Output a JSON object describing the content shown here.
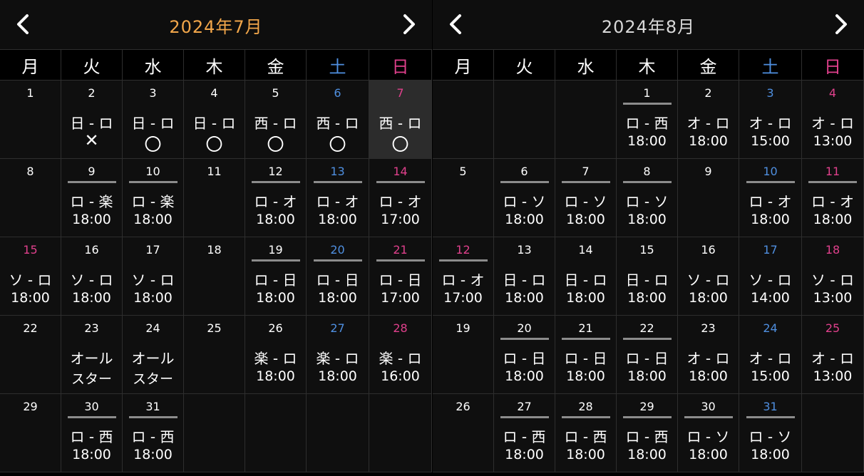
{
  "colors": {
    "title_july": "#f2a64a",
    "title_aug": "#d8d8d8",
    "saturday": "#4f8fe0",
    "sunday": "#e0408c"
  },
  "icons": {
    "prev": "chevron-left-icon",
    "next": "chevron-right-icon"
  },
  "weekdays": [
    "月",
    "火",
    "水",
    "木",
    "金",
    "土",
    "日"
  ],
  "months": [
    {
      "title": "2024年7月",
      "weeks": [
        [
          {
            "day": "1",
            "t1": "",
            "t2": "",
            "bar": false
          },
          {
            "day": "2",
            "t1": "日 - ロ",
            "t2": "✕",
            "bar": false
          },
          {
            "day": "3",
            "t1": "日 - ロ",
            "t2": "〇",
            "bar": false
          },
          {
            "day": "4",
            "t1": "日 - ロ",
            "t2": "〇",
            "bar": false
          },
          {
            "day": "5",
            "t1": "西 - ロ",
            "t2": "〇",
            "bar": false
          },
          {
            "day": "6",
            "t1": "西 - ロ",
            "t2": "〇",
            "bar": false
          },
          {
            "day": "7",
            "t1": "西 - ロ",
            "t2": "〇",
            "bar": false,
            "today": true
          }
        ],
        [
          {
            "day": "8",
            "t1": "",
            "t2": "",
            "bar": false
          },
          {
            "day": "9",
            "t1": "ロ - 楽",
            "t2": "18:00",
            "bar": true
          },
          {
            "day": "10",
            "t1": "ロ - 楽",
            "t2": "18:00",
            "bar": true
          },
          {
            "day": "11",
            "t1": "",
            "t2": "",
            "bar": false
          },
          {
            "day": "12",
            "t1": "ロ - オ",
            "t2": "18:00",
            "bar": true
          },
          {
            "day": "13",
            "t1": "ロ - オ",
            "t2": "18:00",
            "bar": true
          },
          {
            "day": "14",
            "t1": "ロ - オ",
            "t2": "17:00",
            "bar": true
          }
        ],
        [
          {
            "day": "15",
            "t1": "ソ - ロ",
            "t2": "18:00",
            "bar": false,
            "holiday": true
          },
          {
            "day": "16",
            "t1": "ソ - ロ",
            "t2": "18:00",
            "bar": false
          },
          {
            "day": "17",
            "t1": "ソ - ロ",
            "t2": "18:00",
            "bar": false
          },
          {
            "day": "18",
            "t1": "",
            "t2": "",
            "bar": false
          },
          {
            "day": "19",
            "t1": "ロ - 日",
            "t2": "18:00",
            "bar": true
          },
          {
            "day": "20",
            "t1": "ロ - 日",
            "t2": "18:00",
            "bar": true
          },
          {
            "day": "21",
            "t1": "ロ - 日",
            "t2": "17:00",
            "bar": true
          }
        ],
        [
          {
            "day": "22",
            "t1": "",
            "t2": "",
            "bar": false
          },
          {
            "day": "23",
            "t1": "オール",
            "t2": "スター",
            "bar": false
          },
          {
            "day": "24",
            "t1": "オール",
            "t2": "スター",
            "bar": false
          },
          {
            "day": "25",
            "t1": "",
            "t2": "",
            "bar": false
          },
          {
            "day": "26",
            "t1": "楽 - ロ",
            "t2": "18:00",
            "bar": false
          },
          {
            "day": "27",
            "t1": "楽 - ロ",
            "t2": "18:00",
            "bar": false
          },
          {
            "day": "28",
            "t1": "楽 - ロ",
            "t2": "16:00",
            "bar": false
          }
        ],
        [
          {
            "day": "29",
            "t1": "",
            "t2": "",
            "bar": false
          },
          {
            "day": "30",
            "t1": "ロ - 西",
            "t2": "18:00",
            "bar": true
          },
          {
            "day": "31",
            "t1": "ロ - 西",
            "t2": "18:00",
            "bar": true
          },
          null,
          null,
          null,
          null
        ]
      ]
    },
    {
      "title": "2024年8月",
      "weeks": [
        [
          null,
          null,
          null,
          {
            "day": "1",
            "t1": "ロ - 西",
            "t2": "18:00",
            "bar": true
          },
          {
            "day": "2",
            "t1": "オ - ロ",
            "t2": "18:00",
            "bar": false
          },
          {
            "day": "3",
            "t1": "オ - ロ",
            "t2": "15:00",
            "bar": false
          },
          {
            "day": "4",
            "t1": "オ - ロ",
            "t2": "13:00",
            "bar": false
          }
        ],
        [
          {
            "day": "5",
            "t1": "",
            "t2": "",
            "bar": false
          },
          {
            "day": "6",
            "t1": "ロ - ソ",
            "t2": "18:00",
            "bar": true
          },
          {
            "day": "7",
            "t1": "ロ - ソ",
            "t2": "18:00",
            "bar": true
          },
          {
            "day": "8",
            "t1": "ロ - ソ",
            "t2": "18:00",
            "bar": true
          },
          {
            "day": "9",
            "t1": "",
            "t2": "",
            "bar": false
          },
          {
            "day": "10",
            "t1": "ロ - オ",
            "t2": "18:00",
            "bar": true
          },
          {
            "day": "11",
            "t1": "ロ - オ",
            "t2": "18:00",
            "bar": true
          }
        ],
        [
          {
            "day": "12",
            "t1": "ロ - オ",
            "t2": "17:00",
            "bar": true,
            "holiday": true
          },
          {
            "day": "13",
            "t1": "日 - ロ",
            "t2": "18:00",
            "bar": false
          },
          {
            "day": "14",
            "t1": "日 - ロ",
            "t2": "18:00",
            "bar": false
          },
          {
            "day": "15",
            "t1": "日 - ロ",
            "t2": "18:00",
            "bar": false
          },
          {
            "day": "16",
            "t1": "ソ - ロ",
            "t2": "18:00",
            "bar": false
          },
          {
            "day": "17",
            "t1": "ソ - ロ",
            "t2": "14:00",
            "bar": false
          },
          {
            "day": "18",
            "t1": "ソ - ロ",
            "t2": "13:00",
            "bar": false
          }
        ],
        [
          {
            "day": "19",
            "t1": "",
            "t2": "",
            "bar": false
          },
          {
            "day": "20",
            "t1": "ロ - 日",
            "t2": "18:00",
            "bar": true
          },
          {
            "day": "21",
            "t1": "ロ - 日",
            "t2": "18:00",
            "bar": true
          },
          {
            "day": "22",
            "t1": "ロ - 日",
            "t2": "18:00",
            "bar": true
          },
          {
            "day": "23",
            "t1": "オ - ロ",
            "t2": "18:00",
            "bar": false
          },
          {
            "day": "24",
            "t1": "オ - ロ",
            "t2": "15:00",
            "bar": false
          },
          {
            "day": "25",
            "t1": "オ - ロ",
            "t2": "13:00",
            "bar": false
          }
        ],
        [
          {
            "day": "26",
            "t1": "",
            "t2": "",
            "bar": false
          },
          {
            "day": "27",
            "t1": "ロ - 西",
            "t2": "18:00",
            "bar": true
          },
          {
            "day": "28",
            "t1": "ロ - 西",
            "t2": "18:00",
            "bar": true
          },
          {
            "day": "29",
            "t1": "ロ - 西",
            "t2": "18:00",
            "bar": true
          },
          {
            "day": "30",
            "t1": "ロ - ソ",
            "t2": "18:00",
            "bar": true
          },
          {
            "day": "31",
            "t1": "ロ - ソ",
            "t2": "18:00",
            "bar": true
          },
          null
        ]
      ]
    }
  ]
}
